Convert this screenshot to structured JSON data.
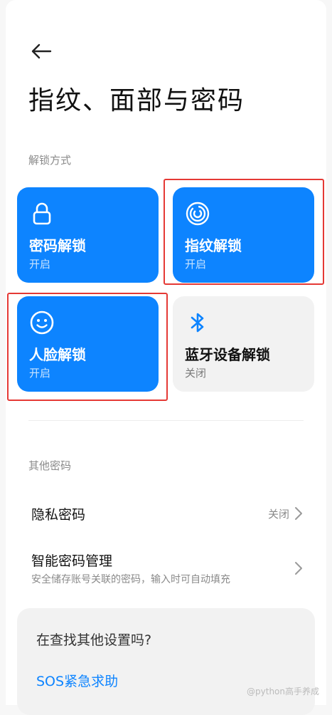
{
  "header": {
    "title": "指纹、面部与密码"
  },
  "unlock_section": {
    "label": "解锁方式",
    "tiles": [
      {
        "label": "密码解锁",
        "status": "开启",
        "icon": "lock-icon",
        "enabled": true
      },
      {
        "label": "指纹解锁",
        "status": "开启",
        "icon": "fingerprint-icon",
        "enabled": true
      },
      {
        "label": "人脸解锁",
        "status": "开启",
        "icon": "face-icon",
        "enabled": true
      },
      {
        "label": "蓝牙设备解锁",
        "status": "关闭",
        "icon": "bluetooth-icon",
        "enabled": false
      }
    ]
  },
  "other_section": {
    "label": "其他密码",
    "items": [
      {
        "title": "隐私密码",
        "value": "关闭"
      },
      {
        "title": "智能密码管理",
        "subtitle": "安全储存账号关联的密码，输入时可自动填充"
      }
    ]
  },
  "search_card": {
    "question": "在查找其他设置吗?",
    "link": "SOS紧急求助"
  },
  "watermark": "@python高手养成",
  "colors": {
    "accent": "#0d84ff",
    "tile_off": "#f2f2f2",
    "highlight": "#e53935",
    "background": "#ffffff"
  }
}
